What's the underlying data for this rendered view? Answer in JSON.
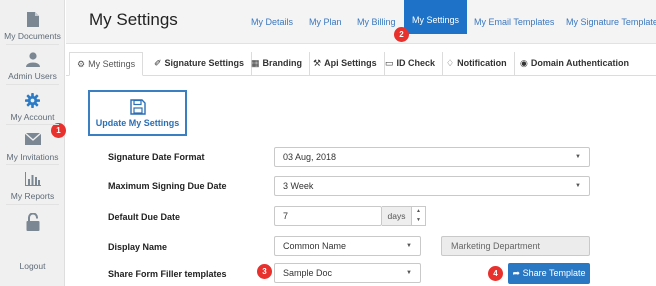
{
  "sidebar": {
    "items": [
      {
        "label": "My Documents",
        "icon": "document-icon"
      },
      {
        "label": "Admin Users",
        "icon": "user-icon"
      },
      {
        "label": "My Account",
        "icon": "gear-icon",
        "badge": "1"
      },
      {
        "label": "My Invitations",
        "icon": "envelope-icon"
      },
      {
        "label": "My Reports",
        "icon": "bar-chart-icon"
      },
      {
        "label": "Logout",
        "icon": "lock-icon"
      }
    ]
  },
  "header": {
    "title": "My Settings",
    "nav": [
      {
        "label": "My Details"
      },
      {
        "label": "My Plan"
      },
      {
        "label": "My Billing"
      },
      {
        "label": "My Settings",
        "active": true,
        "badge": "2"
      },
      {
        "label": "My Email Templates"
      },
      {
        "label": "My Signature Templates"
      }
    ]
  },
  "tabs": [
    {
      "label": "My Settings",
      "icon": "gear-icon",
      "active": true
    },
    {
      "label": "Signature Settings",
      "icon": "pen-icon"
    },
    {
      "label": "Branding",
      "icon": "grid-icon"
    },
    {
      "label": "Api Settings",
      "icon": "wrench-icon"
    },
    {
      "label": "ID Check",
      "icon": "id-card-icon"
    },
    {
      "label": "Notification",
      "icon": "bell-icon"
    },
    {
      "label": "Domain Authentication",
      "icon": "globe-icon"
    }
  ],
  "update_button": {
    "label": "Update My Settings",
    "icon": "save-icon"
  },
  "form": {
    "signature_date_format": {
      "label": "Signature Date Format",
      "value": "03 Aug, 2018"
    },
    "max_signing_due_date": {
      "label": "Maximum Signing Due Date",
      "value": "3 Week"
    },
    "default_due_date": {
      "label": "Default Due Date",
      "value": "7",
      "unit": "days"
    },
    "display_name": {
      "label": "Display Name",
      "value": "Common Name",
      "readonly_value": "Marketing Department"
    },
    "share_form_filler": {
      "label": "Share Form Filler templates",
      "value": "Sample Doc",
      "badge": "3"
    }
  },
  "share_button": {
    "label": "Share Template",
    "icon": "share-icon",
    "badge": "4"
  },
  "colors": {
    "accent": "#2a78c4",
    "badge": "#e8312d",
    "sidebar_bg": "#f0f0f0"
  }
}
